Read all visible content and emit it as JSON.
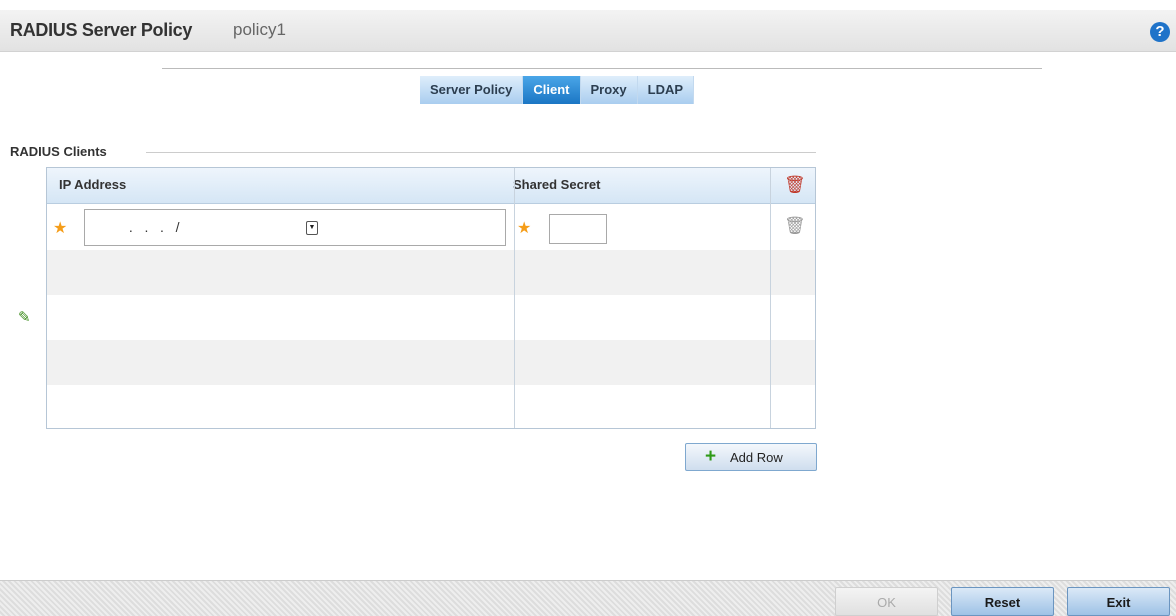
{
  "header": {
    "title": "RADIUS Server Policy",
    "policy_name": "policy1",
    "help_glyph": "?"
  },
  "tabs": [
    {
      "label": "Server Policy",
      "active": false
    },
    {
      "label": "Client",
      "active": true
    },
    {
      "label": "Proxy",
      "active": false
    },
    {
      "label": "LDAP",
      "active": false
    }
  ],
  "section": {
    "label": "RADIUS Clients"
  },
  "table": {
    "columns": [
      "IP Address",
      "Shared Secret"
    ],
    "rows": [
      {
        "ip_address": " .   .   .   / ",
        "shared_secret": ""
      }
    ]
  },
  "add_row_label": "Add Row",
  "footer": {
    "ok_label": "OK",
    "reset_label": "Reset",
    "exit_label": "Exit"
  },
  "icons": [
    "help-icon",
    "delete-all-trash-icon",
    "delete-row-trash-icon",
    "edit-pencil-icon",
    "required-star-icon",
    "plus-icon",
    "dropdown-arrow-icon"
  ],
  "colors": {
    "tab_active": "#1b76c4",
    "required_star": "#f59d19",
    "trash_header": "#c0392b",
    "help_icon": "#1f73c9"
  }
}
